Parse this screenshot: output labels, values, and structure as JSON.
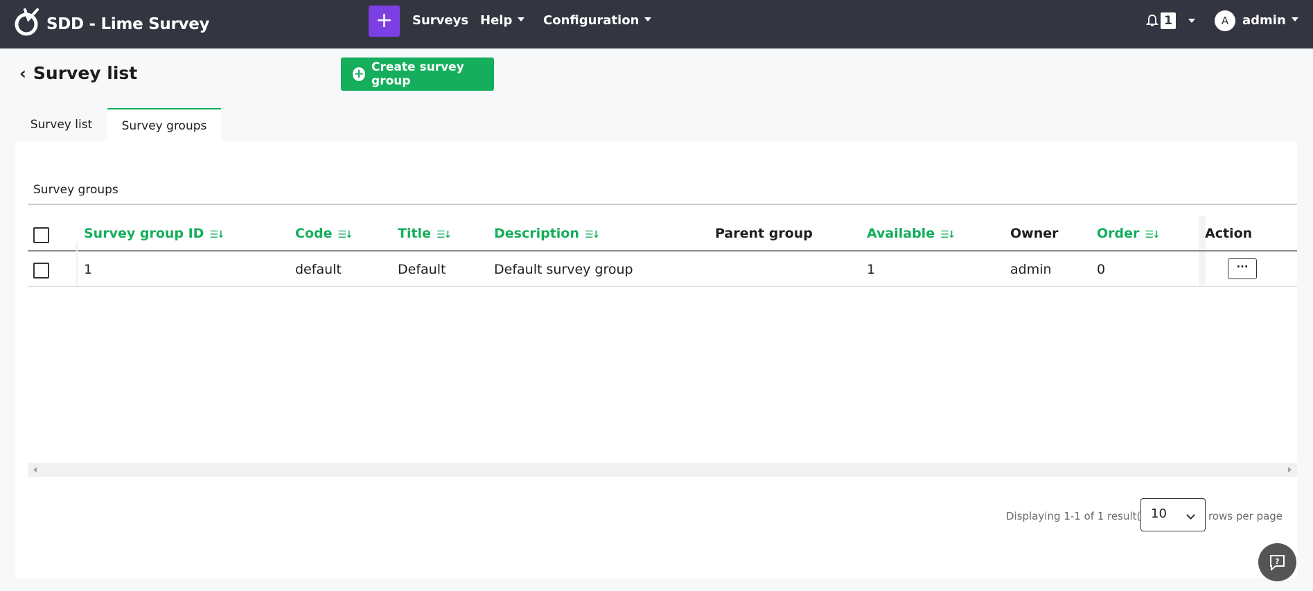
{
  "app": {
    "brand": "SDD - Lime Survey",
    "accent": "#14ae5c",
    "navbar_bg": "#333641",
    "plus_bg": "#7b3fe4"
  },
  "nav": {
    "plus_icon": "plus-icon",
    "surveys": "Surveys",
    "help": "Help",
    "configuration": "Configuration",
    "notification_count": "1",
    "avatar_initial": "A",
    "user": "admin"
  },
  "page": {
    "title": "Survey list",
    "create_button": "Create survey group"
  },
  "tabs": [
    {
      "label": "Survey list",
      "active": false
    },
    {
      "label": "Survey groups",
      "active": true
    }
  ],
  "panel": {
    "title": "Survey groups"
  },
  "table": {
    "columns": [
      {
        "label": "Survey group ID",
        "sortable": true
      },
      {
        "label": "Code",
        "sortable": true
      },
      {
        "label": "Title",
        "sortable": true
      },
      {
        "label": "Description",
        "sortable": true
      },
      {
        "label": "Parent group",
        "sortable": false
      },
      {
        "label": "Available",
        "sortable": true
      },
      {
        "label": "Owner",
        "sortable": false
      },
      {
        "label": "Order",
        "sortable": true
      },
      {
        "label": "Action",
        "sortable": false
      }
    ],
    "rows": [
      {
        "id": "1",
        "code": "default",
        "title": "Default",
        "description": "Default survey group",
        "parent": "",
        "available": "1",
        "owner": "admin",
        "order": "0",
        "action": "···"
      }
    ]
  },
  "pager": {
    "summary": "Displaying 1-1 of 1 result(s).",
    "rows_per_page_value": "10",
    "rows_per_page_label": "rows per page"
  }
}
